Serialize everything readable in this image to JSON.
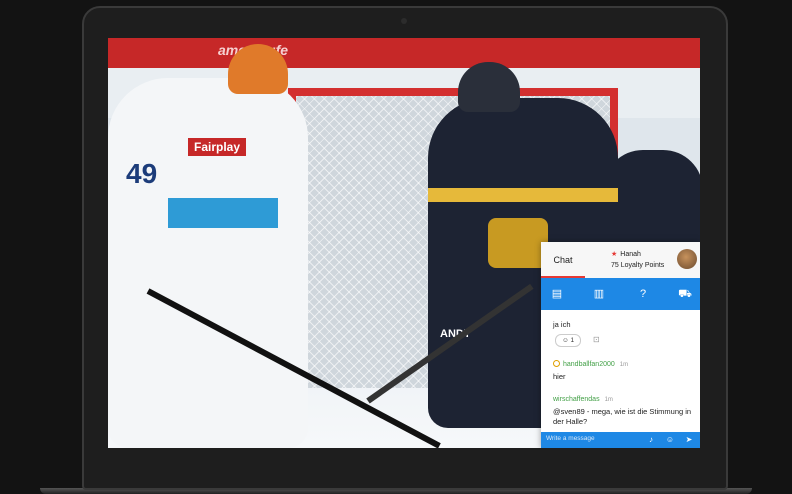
{
  "scene": {
    "ad_text": "amerkaufe"
  },
  "players": {
    "white_number": "49",
    "white_logo": "Fairplay",
    "dark_sponsor": "ANDT"
  },
  "chat": {
    "tab_label": "Chat",
    "user_name": "Hanah",
    "loyalty": "75 Loyalty Points",
    "tools": [
      "chat-icon",
      "bar-chart-icon",
      "help-icon",
      "cart-icon"
    ],
    "messages": [
      {
        "text": "ja ich",
        "reaction_count": "1"
      },
      {
        "user": "handballfan2000",
        "time": "1m",
        "text": "hier"
      },
      {
        "user": "wirschaffendas",
        "time": "1m",
        "text": "@sven89 - mega, wie ist die Stimmung in der Halle?"
      }
    ],
    "input_placeholder": "Write a message"
  },
  "colors": {
    "accent": "#1e88e5",
    "goal": "#d32f2f",
    "username": "#43a047"
  }
}
